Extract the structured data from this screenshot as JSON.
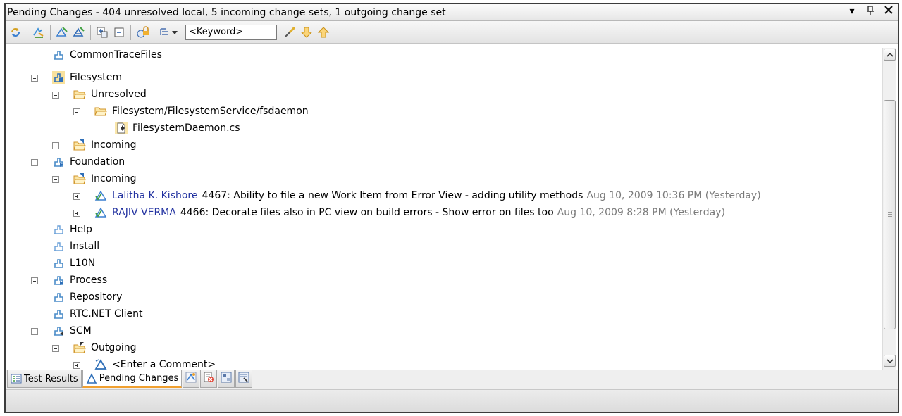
{
  "window": {
    "title": "Pending Changes - 404 unresolved local, 5 incoming change sets, 1 outgoing change set",
    "controls": [
      "▾",
      "ᵖ",
      "✕"
    ]
  },
  "toolbar": {
    "keyword_placeholder": "<Keyword>",
    "buttons": [
      "refresh-icon",
      "accept-icon",
      "deliver-icon",
      "deliver-all-icon",
      "expand-all-icon",
      "collapse-all-icon",
      "lock-icon",
      "group-by-icon",
      "find-icon",
      "next-icon",
      "previous-icon"
    ]
  },
  "tree": {
    "items": [
      {
        "label": "CommonTraceFiles",
        "icon": "component-icon"
      },
      {
        "label": "Filesystem",
        "icon": "component-icon"
      },
      {
        "label": "Unresolved",
        "icon": "folder-icon"
      },
      {
        "label": "Filesystem/FilesystemService/fsdaemon",
        "icon": "folder-icon"
      },
      {
        "label": "FilesystemDaemon.cs",
        "icon": "file-icon"
      },
      {
        "label": "Incoming",
        "icon": "incoming-folder-icon"
      },
      {
        "label": "Foundation",
        "icon": "component-icon"
      },
      {
        "label": "Incoming",
        "icon": "incoming-folder-icon"
      },
      {
        "author": "Lalitha K. Kishore",
        "label": "4467: Ability to file a new Work Item from Error View - adding utility methods",
        "date": "Aug 10, 2009 10:36 PM (Yesterday)",
        "icon": "change-set-icon"
      },
      {
        "author": "RAJIV VERMA",
        "label": "4466: Decorate files also in PC view on build errors - Show error on files too",
        "date": "Aug 10, 2009 8:28 PM (Yesterday)",
        "icon": "change-set-icon"
      },
      {
        "label": "Help",
        "icon": "component-icon"
      },
      {
        "label": "Install",
        "icon": "component-icon"
      },
      {
        "label": "L10N",
        "icon": "component-icon"
      },
      {
        "label": "Process",
        "icon": "component-icon"
      },
      {
        "label": "Repository",
        "icon": "component-icon"
      },
      {
        "label": "RTC.NET Client",
        "icon": "component-icon"
      },
      {
        "label": "SCM",
        "icon": "component-icon"
      },
      {
        "label": "Outgoing",
        "icon": "outgoing-folder-icon"
      },
      {
        "label": "<Enter a Comment>",
        "icon": "change-set-icon"
      }
    ]
  },
  "tabs": {
    "test_results": "Test Results",
    "pending_changes": "Pending Changes"
  }
}
